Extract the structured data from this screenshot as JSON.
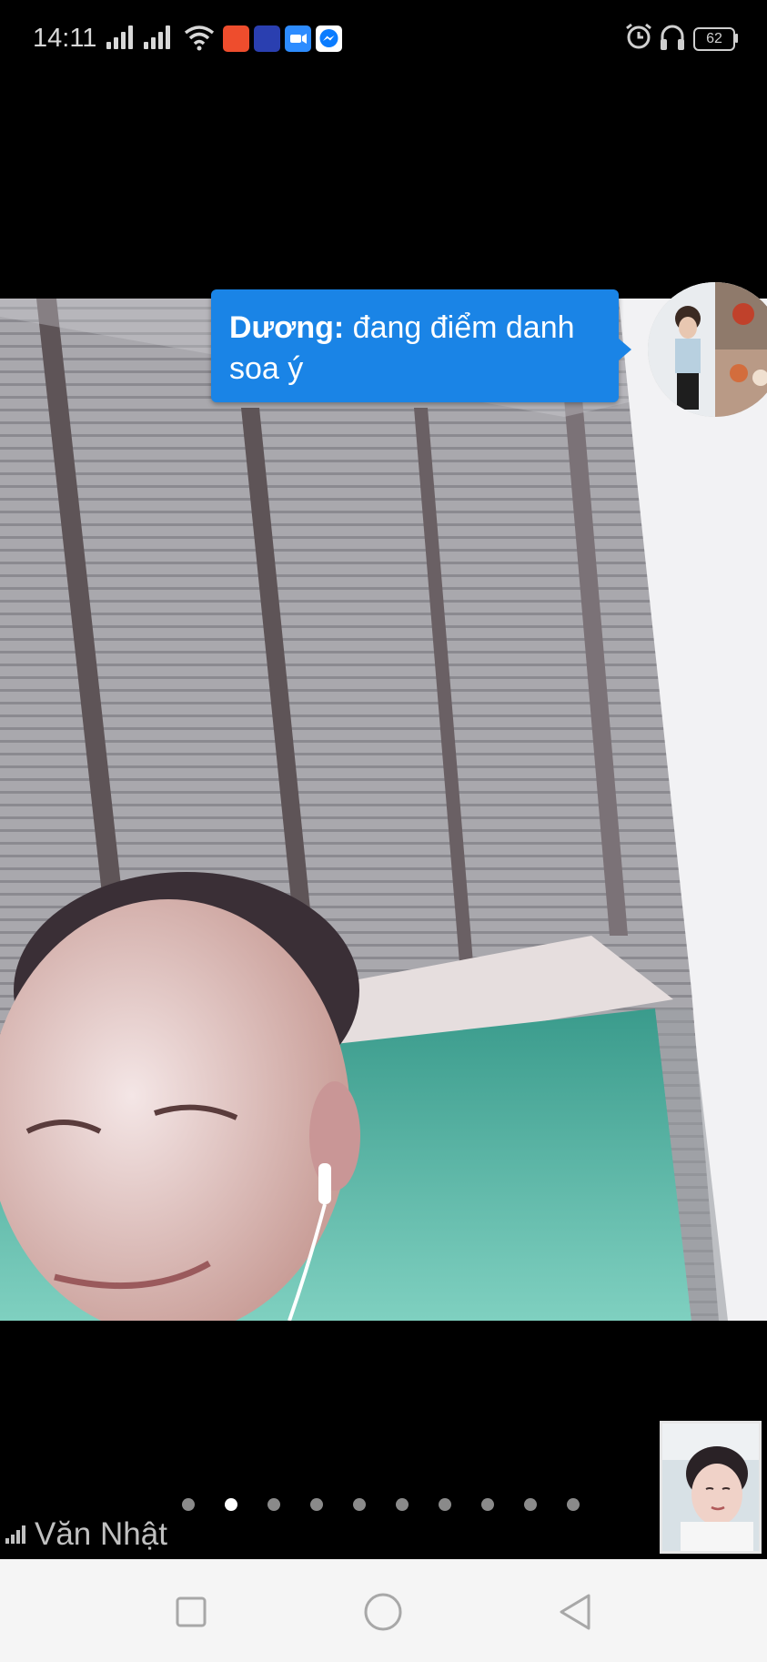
{
  "status_bar": {
    "time": "14:11",
    "battery_level": "62",
    "icons": [
      "signal-icon",
      "signal-icon",
      "wifi-icon",
      "shopee-app-icon",
      "game-app-icon",
      "zoom-app-icon",
      "messenger-app-icon",
      "alarm-icon",
      "headset-icon",
      "battery-icon"
    ]
  },
  "chat_bubble": {
    "sender": "Dương:",
    "message": " đang điểm danh soa ý"
  },
  "call": {
    "caller_name": "Văn Nhật",
    "pages_total": 10,
    "active_page": 2
  },
  "nav_bar": {
    "buttons": [
      "recent-apps-button",
      "home-button",
      "back-button"
    ]
  },
  "colors": {
    "bubble": "#1a84e6",
    "background": "#000000",
    "nav_bar": "#f5f5f5"
  }
}
